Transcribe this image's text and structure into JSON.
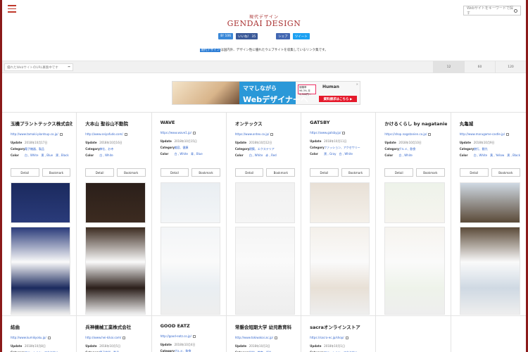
{
  "header": {
    "subtitle": "現代デザイン",
    "title": "GENDAI DESIGN",
    "search_placeholder": "Webサイトをキーワードで探す"
  },
  "social": [
    {
      "label": "B! 106",
      "color": "#3a88d8"
    },
    {
      "label": "いいね！ 35",
      "color": "#3b5998"
    },
    {
      "label": "シェア",
      "color": "#4267b2"
    },
    {
      "label": "ツイート",
      "color": "#1da1f2"
    }
  ],
  "description": {
    "highlight": "現代デザイン",
    "text": "は国内外、デザイン性に優れたウェブサイトを収集しているリンク集です。"
  },
  "url_input": {
    "placeholder": "優れたWebサイトのURL募集中です"
  },
  "per_page_tabs": [
    "12",
    "60",
    "120"
  ],
  "ad": {
    "line1": "ママしながら",
    "line2": "Webデザイナーへ",
    "badge": "就職率 96.3% 月3,300円〜",
    "brand": "Human",
    "cta": "資料請求はこちら ▶"
  },
  "labels": {
    "update": "Update",
    "category": "Category",
    "color": "Color",
    "detail": "Detail",
    "bookmark": "Bookmark"
  },
  "sites": [
    {
      "name": "玉機プラントテックス株式会社",
      "url": "http://www.tamaki-plantsup.co.jp/",
      "update": "2018年10月17日",
      "category": "電子機器、製品",
      "colors": "白 , White　黒 , Blue　黒 , Black",
      "bg1": "#1b2a5e",
      "bg2": "#2a3b7a"
    },
    {
      "name": "大本山 聖谷山不動院",
      "url": "http://www.seiyafudo.com/",
      "update": "2018年10月16日",
      "category": "神社、お寺",
      "colors": "白 , White",
      "bg1": "#2b1f1a",
      "bg2": "#3c2b20"
    },
    {
      "name": "WAVE",
      "url": "https://www.wave1.jp/",
      "update": "2018年10月15日",
      "category": "美容、健康",
      "colors": "白 , White　青 , Blue",
      "bg1": "#e9eef2",
      "bg2": "#f3f5f7"
    },
    {
      "name": "オンテックス",
      "url": "https://www.ontex.co.jp/",
      "update": "2018年10月12日",
      "category": "建築、エクステリア",
      "colors": "白 , White　赤 , Red",
      "bg1": "#f2f2f2",
      "bg2": "#f5f5f5"
    },
    {
      "name": "GATSBY",
      "url": "https://www.gatsby.jp/",
      "update": "2018年10月11日",
      "category": "ファッション、アクセサリー",
      "colors": "黒 , Gray　白 , White",
      "bg1": "#e8e0d6",
      "bg2": "#f4f0ea"
    },
    {
      "name": "かけるくらし by nagatanien",
      "url": "https://shop.nagatanien.co.jp/",
      "update": "2018年10月10日",
      "category": "グルメ、飲食",
      "colors": "白 , White",
      "bg1": "#eef3ea",
      "bg2": "#f6f4ef"
    },
    {
      "name": "丸亀城",
      "url": "http://www.marugame-castle.jp/",
      "update": "2018年10月9日",
      "category": "旅行、観光",
      "colors": "白 , White　黄 , Yellow　黒 , Black",
      "bg1": "#cfd9e3",
      "bg2": "#5b4a38"
    }
  ],
  "sites_row2": [
    {
      "name": "結曲",
      "url": "http://www.kumikyoku.jp/",
      "update": "2018年10月8日",
      "category": "ファッション、アクセサリー"
    },
    {
      "name": "兵神機械工業株式会社",
      "url": "http://www.hei-kikai.com/",
      "update": "2018年10月5日",
      "category": "電子機器、製品"
    },
    {
      "name": "GOOD EATZ",
      "url": "http://good-eatz.co.jp/",
      "update": "2018年10月4日",
      "category": "グルメ、飲食"
    },
    {
      "name": "常磐会短期大学 幼児教育科",
      "url": "http://www.tokiwakai.ac.jp/",
      "update": "2018年10月3日",
      "category": "学校、教育、福祉"
    },
    {
      "name": "sacraオンラインストア",
      "url": "https://sacra-ec.jp/shop/",
      "update": "2018年10月1日",
      "category": "ファッション、アクセサリー"
    }
  ]
}
